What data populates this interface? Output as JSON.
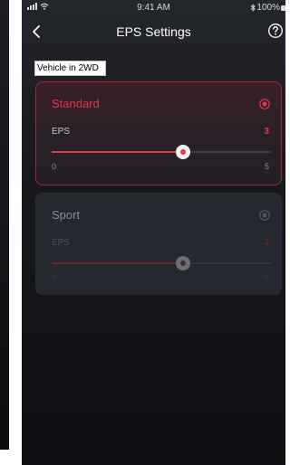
{
  "status_bar": {
    "time": "9:41 AM",
    "battery": "100%"
  },
  "header": {
    "title": "EPS Settings",
    "back_icon": "chevron-left-icon",
    "help_icon": "question-circle-icon"
  },
  "mode_label": "Vehicle in 2WD",
  "modes": [
    {
      "name": "Standard",
      "selected": true,
      "param_label": "EPS",
      "value": "3",
      "level": 3,
      "min": "0",
      "max": "5"
    },
    {
      "name": "Sport",
      "selected": false,
      "param_label": "EPS",
      "value": "3",
      "level": 3,
      "min": "0",
      "max": "5"
    }
  ],
  "colors": {
    "accent": "#e03a4c",
    "background": "#17181d",
    "card_inactive": "#262830"
  }
}
